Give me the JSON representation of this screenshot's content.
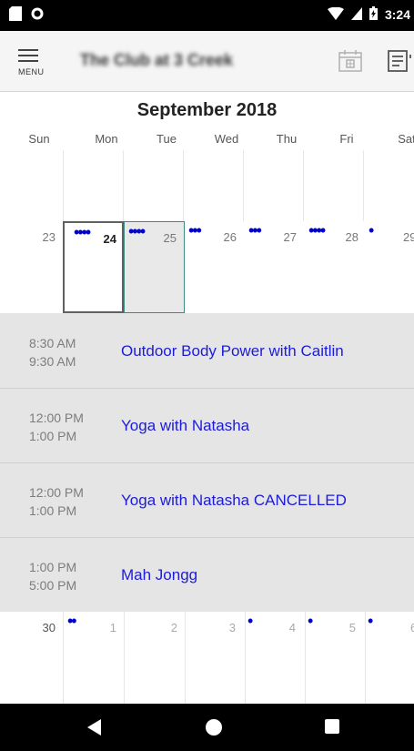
{
  "status_bar": {
    "time": "3:24",
    "icons": [
      "sd-card-icon",
      "circle-icon",
      "wifi-icon",
      "signal-icon",
      "battery-icon"
    ]
  },
  "app_bar": {
    "menu_label": "MENU",
    "club_name": "The Club at 3 Creek",
    "icons": [
      "calendar-view-icon",
      "list-view-icon"
    ]
  },
  "calendar": {
    "month_title": "September 2018",
    "weekdays": [
      "Sun",
      "Mon",
      "Tue",
      "Wed",
      "Thu",
      "Fri",
      "Sat"
    ],
    "week1": [
      {
        "day": "23",
        "dots": ""
      },
      {
        "day": "24",
        "dots": "••••"
      },
      {
        "day": "25",
        "dots": "••••"
      },
      {
        "day": "26",
        "dots": "•••"
      },
      {
        "day": "27",
        "dots": "•••"
      },
      {
        "day": "28",
        "dots": "••••"
      },
      {
        "day": "29",
        "dots": "•"
      }
    ],
    "week2": [
      {
        "day": "30",
        "dots": "••"
      },
      {
        "day": "1",
        "dots": ""
      },
      {
        "day": "2",
        "dots": ""
      },
      {
        "day": "3",
        "dots": "•"
      },
      {
        "day": "4",
        "dots": "•"
      },
      {
        "day": "5",
        "dots": "•"
      },
      {
        "day": "6",
        "dots": ""
      }
    ]
  },
  "events": [
    {
      "start": "8:30 AM",
      "end": "9:30 AM",
      "title": "Outdoor Body Power with Caitlin"
    },
    {
      "start": "12:00 PM",
      "end": "1:00 PM",
      "title": "Yoga with Natasha"
    },
    {
      "start": "12:00 PM",
      "end": "1:00 PM",
      "title": "Yoga with Natasha CANCELLED"
    },
    {
      "start": "1:00 PM",
      "end": "5:00 PM",
      "title": "Mah Jongg"
    }
  ],
  "colors": {
    "event_title": "#1c1bdb",
    "dot": "#0000cc",
    "today_border": "#3d8a80",
    "selected_border": "#616161",
    "event_bg": "#e5e5e5"
  }
}
